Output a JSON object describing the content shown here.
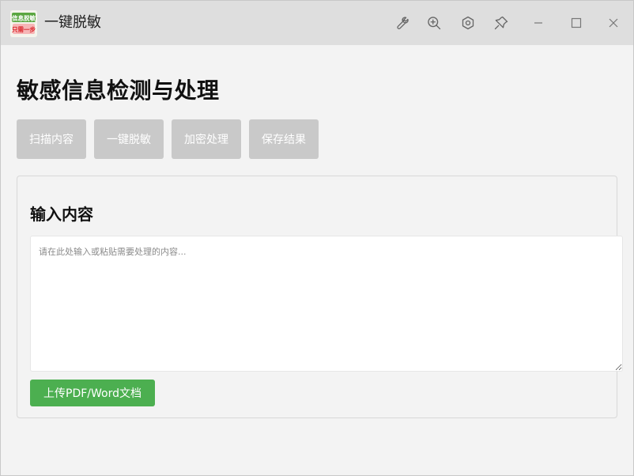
{
  "window": {
    "title": "一键脱敏",
    "icon_text_top": "信息脱敏",
    "icon_text_bottom": "只需一步"
  },
  "titlebar_buttons": [
    {
      "name": "wrench-icon"
    },
    {
      "name": "zoom-in-icon"
    },
    {
      "name": "settings-icon"
    },
    {
      "name": "pin-icon"
    },
    {
      "name": "minimize-icon"
    },
    {
      "name": "maximize-icon"
    },
    {
      "name": "close-icon"
    }
  ],
  "main": {
    "title": "敏感信息检测与处理",
    "actions": {
      "scan": "扫描内容",
      "desensitize": "一键脱敏",
      "encrypt": "加密处理",
      "save": "保存结果"
    },
    "input_panel": {
      "title": "输入内容",
      "placeholder": "请在此处输入或粘贴需要处理的内容...",
      "value": "",
      "upload_label": "上传PDF/Word文档"
    }
  },
  "colors": {
    "titlebar": "#dedede",
    "background": "#f3f3f3",
    "disabled_button": "#c9c9c9",
    "upload_button": "#4caf50"
  }
}
